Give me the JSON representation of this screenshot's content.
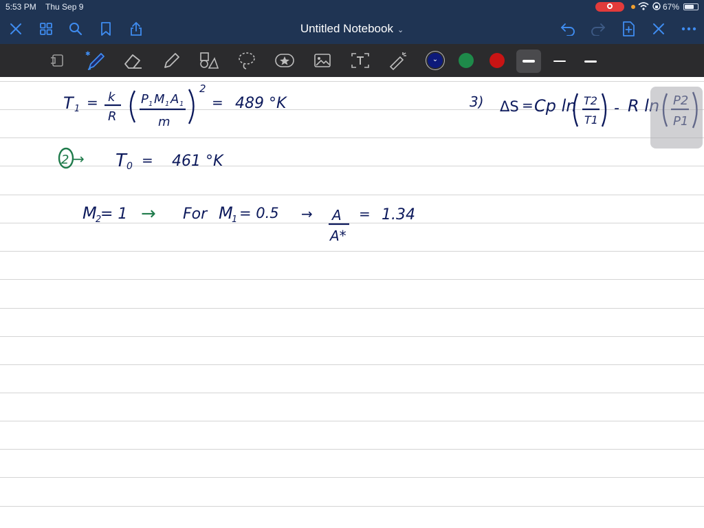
{
  "status": {
    "time": "5:53 PM",
    "date": "Thu Sep 9",
    "battery": "67%"
  },
  "nav": {
    "title": "Untitled Notebook",
    "icons": [
      "close-icon",
      "grid-icon",
      "search-icon",
      "bookmark-icon",
      "share-icon",
      "undo-icon",
      "redo-icon",
      "add-page-icon",
      "close-all-icon",
      "more-icon"
    ]
  },
  "toolbar": {
    "tools": [
      "lasso-view-icon",
      "pen-icon",
      "eraser-icon",
      "highlighter-icon",
      "shapes-icon",
      "lasso-icon",
      "sticker-icon",
      "image-icon",
      "text-icon",
      "laser-pointer-icon"
    ],
    "selected_tool": "pen",
    "colors": [
      "#0d1a7a",
      "#1e8a4a",
      "#c81414"
    ],
    "selected_color": "#0d1a7a",
    "thickness": [
      "thick",
      "thin",
      "medium"
    ],
    "selected_thickness": "thick"
  },
  "notes": {
    "line1": {
      "lhs": "T",
      "lhs_sub": "1",
      "eq": "=",
      "frac_num": "k",
      "frac_den": "R",
      "inner_num": "P",
      "inner_num_sub": "1",
      "inner_m": "M",
      "inner_m_sub": "1",
      "inner_a": "A",
      "inner_a_sub": "1",
      "inner_den": "m",
      "exp": "2",
      "eq2": "=",
      "result": "489 °K"
    },
    "line2": {
      "label": "2",
      "arrow": "→",
      "lhs": "T",
      "lhs_sub": "0",
      "eq": "=",
      "result": "461 °K"
    },
    "line3": {
      "lhs": "M",
      "lhs_sub": "2",
      "eq": "= 1",
      "arrow": "→",
      "for": "For",
      "m1": "M",
      "m1_sub": "1",
      "m1_val": "= 0.5",
      "arrow2": "→",
      "frac_num": "A",
      "frac_den": "A*",
      "eq2": "=",
      "result": "1.34"
    },
    "line4": {
      "label": "3)",
      "ds": "ΔS",
      "eq": "=",
      "cp": "Cp ln",
      "t_num": "T2",
      "t_den": "T1",
      "minus": "-",
      "r": "R ln",
      "p_num": "P2",
      "p_den": "P1"
    }
  }
}
